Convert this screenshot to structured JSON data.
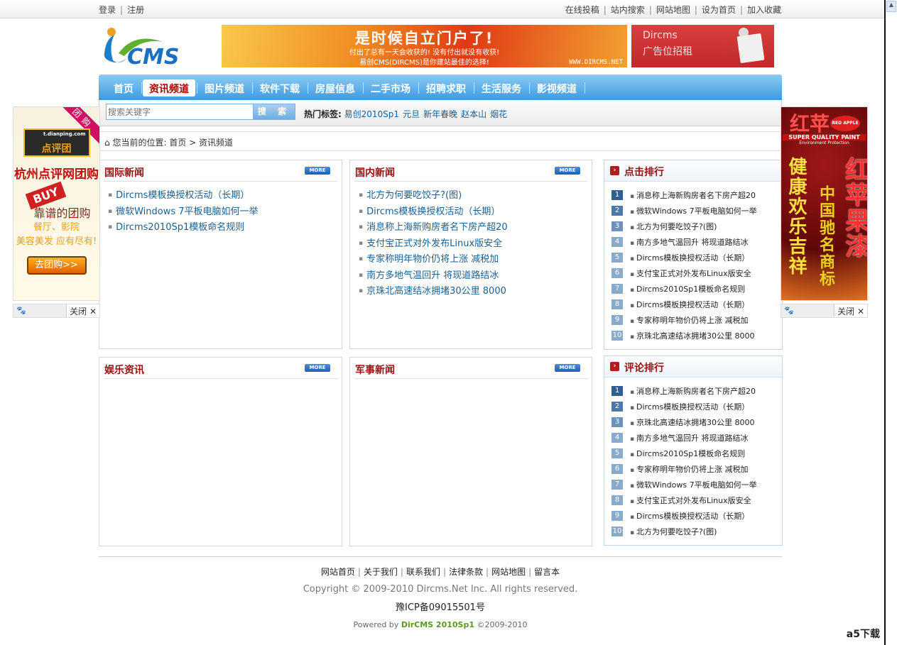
{
  "topbar": {
    "login": "登录",
    "register": "注册",
    "links": [
      "在线投稿",
      "站内搜索",
      "网站地图",
      "设为首页",
      "加入收藏"
    ]
  },
  "header": {
    "logo_text": "CMS",
    "banner": {
      "headline": "是时候自立门户了!",
      "line1": "付出了总有一天会收获的! 没有付出就没有收获!",
      "line2": "易创CMS(DIRCMS)是你建站最佳的选择!",
      "url": "WWW.DIRCMS.NET"
    },
    "ad": {
      "line1": "Dircms",
      "line2": "广告位招租"
    }
  },
  "nav": [
    "首页",
    "资讯频道",
    "图片频道",
    "软件下载",
    "房屋信息",
    "二手市场",
    "招聘求职",
    "生活服务",
    "影视频道"
  ],
  "search": {
    "placeholder": "搜索关键字",
    "button": "搜 索",
    "hot_label": "热门标签:",
    "tags": [
      "易创2010Sp1",
      "元旦",
      "新年春晚",
      "赵本山",
      "烟花"
    ]
  },
  "breadcrumb": {
    "label": "您当前的位置:",
    "home": "首页",
    "current": "资讯频道"
  },
  "more_label": "MORE",
  "boxes": [
    {
      "title": "国际新闻",
      "items": [
        "Dircms模板换授权活动（长期）",
        "微软Windows 7平板电脑如何一举",
        "Dircms2010Sp1模板命名规则"
      ]
    },
    {
      "title": "国内新闻",
      "items": [
        "北方为何要吃饺子?(图)",
        "Dircms模板换授权活动（长期）",
        "消息称上海新购房者名下房产超20",
        "支付宝正式对外发布Linux版安全",
        "专家称明年物价仍将上涨 减税加",
        "南方多地气温回升 将现道路结冰",
        "京珠北高速结冰拥堵30公里 8000"
      ]
    },
    {
      "title": "娱乐资讯",
      "items": []
    },
    {
      "title": "军事新闻",
      "items": []
    }
  ],
  "rank_click": {
    "title": "点击排行",
    "items": [
      "消息称上海新购房者名下房产超20",
      "微软Windows 7平板电脑如何一举",
      "北方为何要吃饺子?(图)",
      "南方多地气温回升 将现道路结冰",
      "Dircms模板换授权活动（长期）",
      "支付宝正式对外发布Linux版安全",
      "Dircms2010Sp1模板命名规则",
      "Dircms模板换授权活动（长期）",
      "专家称明年物价仍将上涨 减税加",
      "京珠北高速结冰拥堵30公里 8000"
    ]
  },
  "rank_comment": {
    "title": "评论排行",
    "items": [
      "消息称上海新购房者名下房产超20",
      "Dircms模板换授权活动（长期）",
      "京珠北高速结冰拥堵30公里 8000",
      "南方多地气温回升 将现道路结冰",
      "Dircms2010Sp1模板命名规则",
      "专家称明年物价仍将上涨 减税加",
      "微软Windows 7平板电脑如何一举",
      "支付宝正式对外发布Linux版安全",
      "Dircms模板换授权活动（长期）",
      "北方为何要吃饺子?(图)"
    ]
  },
  "float_ads": {
    "close": "关闭",
    "left": {
      "site": "t.dianping.com",
      "brand": "点评团",
      "ribbon": "团购",
      "title": "杭州点评网团购",
      "buy": "BUY",
      "slogan": "靠谱的团购",
      "line1": "餐厅、影院",
      "line2": "美容美发 应有尽有!",
      "button": "去团购>>"
    },
    "right": {
      "brand": "红苹",
      "tag": "RED APPLE",
      "sub1": "SUPER QUALITY PAINT",
      "sub2": "Environment Protection",
      "col1": "健康欢乐吉祥",
      "col2": "中国驰名商标",
      "col3": "红苹果漆"
    }
  },
  "footer": {
    "links": [
      "网站首页",
      "关于我们",
      "联系我们",
      "法律条款",
      "网站地图",
      "留言本"
    ],
    "copyright": "Copyright © 2009-2010 Dircms.Net Inc. All rights reserved.",
    "icp": "豫ICP备09015501号",
    "powered_prefix": "Powered by",
    "powered_name": "DirCMS 2010Sp1",
    "powered_suffix": "©2009-2010"
  },
  "watermark": {
    "brand": "a5",
    "text": "下载"
  }
}
